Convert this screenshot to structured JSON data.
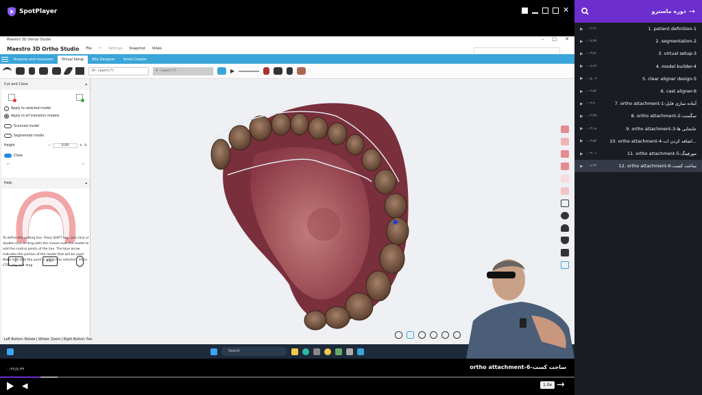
{
  "player": {
    "brand": "SpotPlayer",
    "now_playing": "ortho attachment-6-ساخت کست",
    "time": "۰:۳۶/۸:۳۳",
    "progress": 0.07,
    "buffered": 0.1,
    "speed": "1.0x"
  },
  "app": {
    "window_title": "Maestro 3D Dental Studio",
    "logo": "Maestro 3D Ortho Studio",
    "menu": [
      "File",
      "Settings",
      "Snapshot",
      "Video"
    ],
    "tabs": [
      "Analysis and measures",
      "Virtual Setup",
      "Bite Designer",
      "Smile Creator"
    ],
    "layer_a": "19 - Layer1 (*)",
    "layer_b": "8 - Layer1 (*)",
    "panel": {
      "title": "Cut and Close",
      "opt1": "Apply to selected model",
      "opt2": "Apply to all transition models",
      "tog1": "Scanned model",
      "tog2": "Segmented model",
      "height_label": "Height",
      "height_value": "0.00",
      "close_label": "Close",
      "help_title": "Help",
      "help_text": "To define the cutting line. Press SHIFT key, and click or double-click or drag with the mouse over the model to add the control points of the line. The blue arrow indicates the portion of the model that will be used. Make sure that the point is within the selection. Press CTRL key and drag",
      "next": "Next",
      "cancel": "Cancel"
    },
    "status": "Left Button: Rotate | Wheel: Zoom | Right Button: Pan",
    "taskbar_search": "Search"
  },
  "sidebar": {
    "title": "دوره ماسترو",
    "lessons": [
      {
        "name": "1. patient definition-1",
        "dur": "۰:۰۲:۲۱"
      },
      {
        "name": "2. segmentation-2",
        "dur": "۰:۰۷:۳۷"
      },
      {
        "name": "3. virtual setup-3",
        "dur": "۰:۰۳:۵۱"
      },
      {
        "name": "4. model builder-4",
        "dur": "۰:۰۷:۲۴"
      },
      {
        "name": "5. clear aligner design-5",
        "dur": "۰:۰۵:۰۷"
      },
      {
        "name": "6. cast aligner-6",
        "dur": "۰:۰۶:۵۶"
      },
      {
        "name": "7. ortho attachment-1-آماده سازی فایل",
        "dur": "۰:۰۳:۲۰"
      },
      {
        "name": "8. ortho attachment-2-سگمنت",
        "dur": "۰:۰۲:۳۷"
      },
      {
        "name": "9. ortho attachment-3-جابجایی ها",
        "dur": "۰:۰۳:۱۸"
      },
      {
        "name": "10. ortho attachment-4-اضافه کردن ات...",
        "dur": "۰:۰۳:۵۲"
      },
      {
        "name": "11. ortho attachment-5-مورفینگ",
        "dur": "۰:۰۳:۰۱"
      },
      {
        "name": "12. ortho attachment-6-ساخت کست",
        "dur": "۰:۰۸:۳۳"
      }
    ]
  }
}
